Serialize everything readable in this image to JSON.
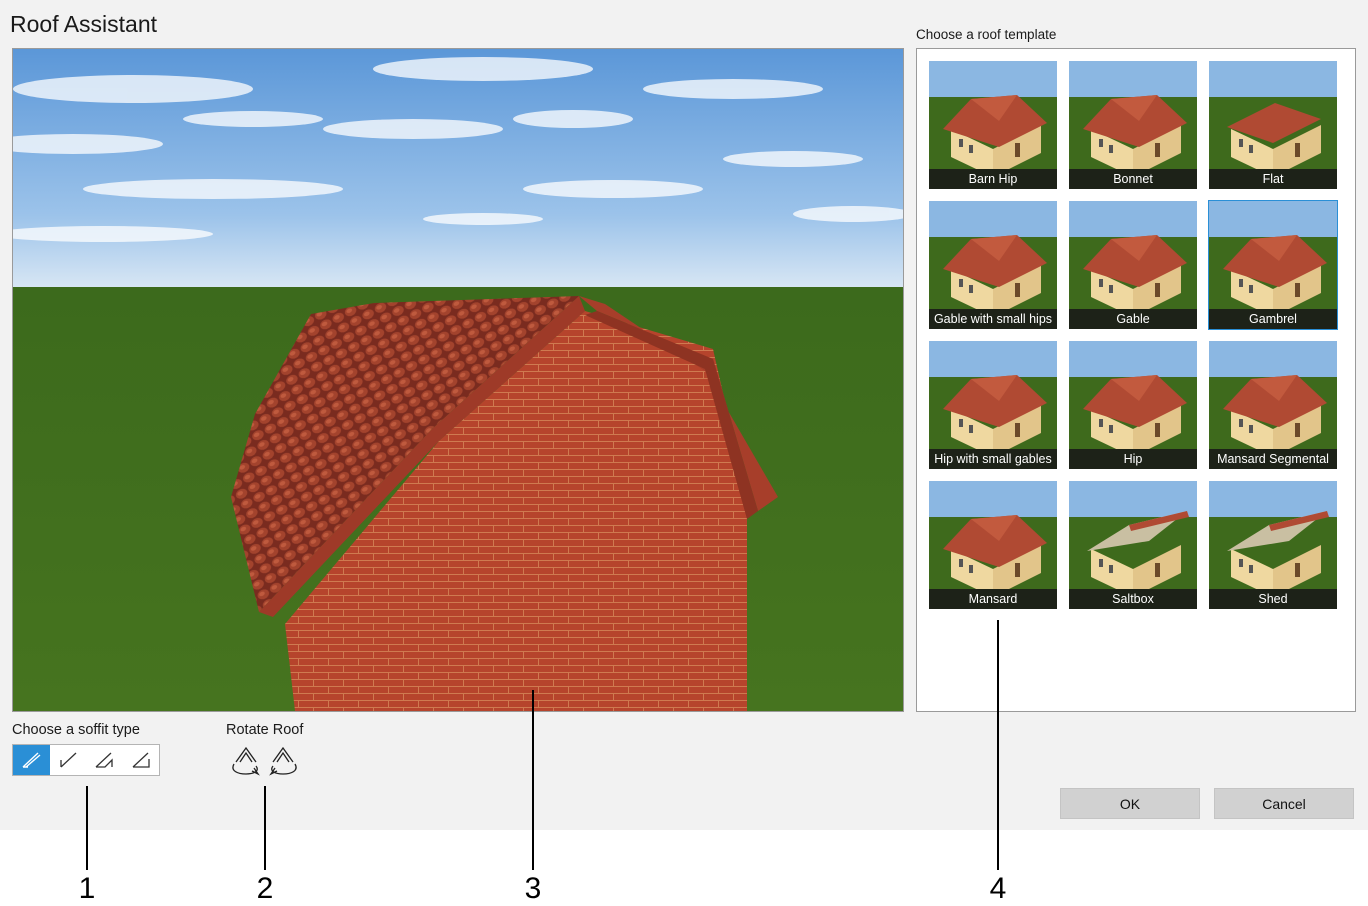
{
  "window": {
    "title": "Roof Assistant"
  },
  "preview": {
    "icon": "3d-roof-preview"
  },
  "soffit": {
    "label": "Choose a soffit type",
    "options": [
      {
        "icon": "soffit-sloped-double-icon",
        "selected": true
      },
      {
        "icon": "soffit-sloped-icon",
        "selected": false
      },
      {
        "icon": "soffit-boxed-icon",
        "selected": false
      },
      {
        "icon": "soffit-horizontal-icon",
        "selected": false
      }
    ]
  },
  "rotate": {
    "label": "Rotate Roof",
    "buttons": [
      {
        "icon": "rotate-roof-left-icon"
      },
      {
        "icon": "rotate-roof-right-icon"
      }
    ]
  },
  "templates": {
    "label": "Choose a roof template",
    "selected": "Gambrel",
    "items": [
      {
        "name": "Barn Hip"
      },
      {
        "name": "Bonnet"
      },
      {
        "name": "Flat"
      },
      {
        "name": "Gable with small hips"
      },
      {
        "name": "Gable"
      },
      {
        "name": "Gambrel"
      },
      {
        "name": "Hip with small gables"
      },
      {
        "name": "Hip"
      },
      {
        "name": "Mansard Segmental"
      },
      {
        "name": "Mansard"
      },
      {
        "name": "Saltbox"
      },
      {
        "name": "Shed"
      }
    ]
  },
  "actions": {
    "ok": "OK",
    "cancel": "Cancel"
  },
  "callouts": [
    "1",
    "2",
    "3",
    "4"
  ],
  "colors": {
    "accent": "#2a8fd6",
    "brick": "#b5442d",
    "grass": "#3f6b1d",
    "sky": "#6fa8e0"
  }
}
